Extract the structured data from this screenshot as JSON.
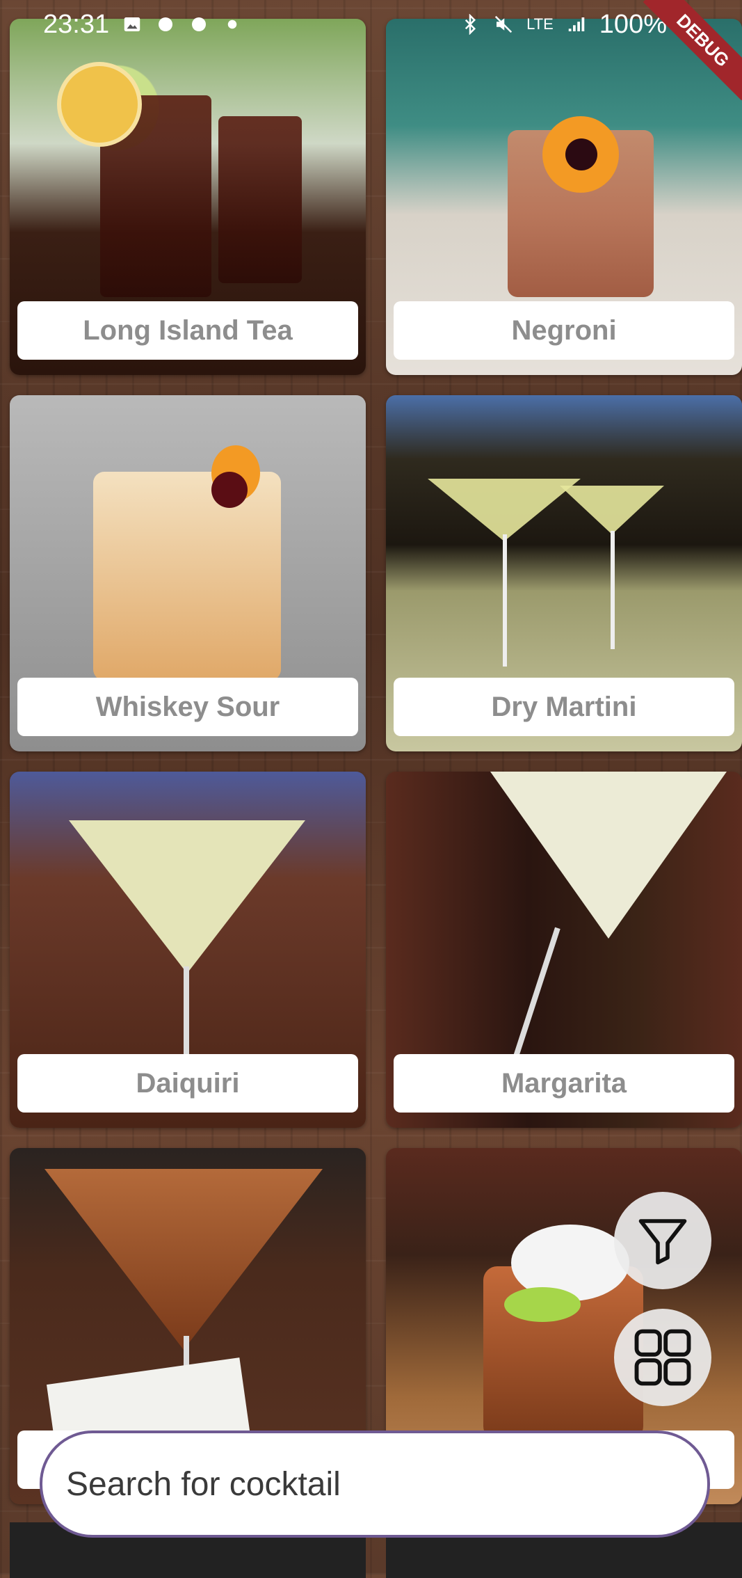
{
  "status_bar": {
    "time": "23:31",
    "battery": "100%",
    "network": "LTE"
  },
  "debug_banner": "DEBUG",
  "cocktails": [
    {
      "name": "Long Island Tea"
    },
    {
      "name": "Negroni"
    },
    {
      "name": "Whiskey Sour"
    },
    {
      "name": "Dry Martini"
    },
    {
      "name": "Daiquiri"
    },
    {
      "name": "Margarita"
    },
    {
      "name": ""
    },
    {
      "name": ""
    }
  ],
  "icons": {
    "filter": "filter-icon",
    "grid": "grid-view-icon"
  },
  "search": {
    "placeholder": "Search for cocktail",
    "value": ""
  }
}
